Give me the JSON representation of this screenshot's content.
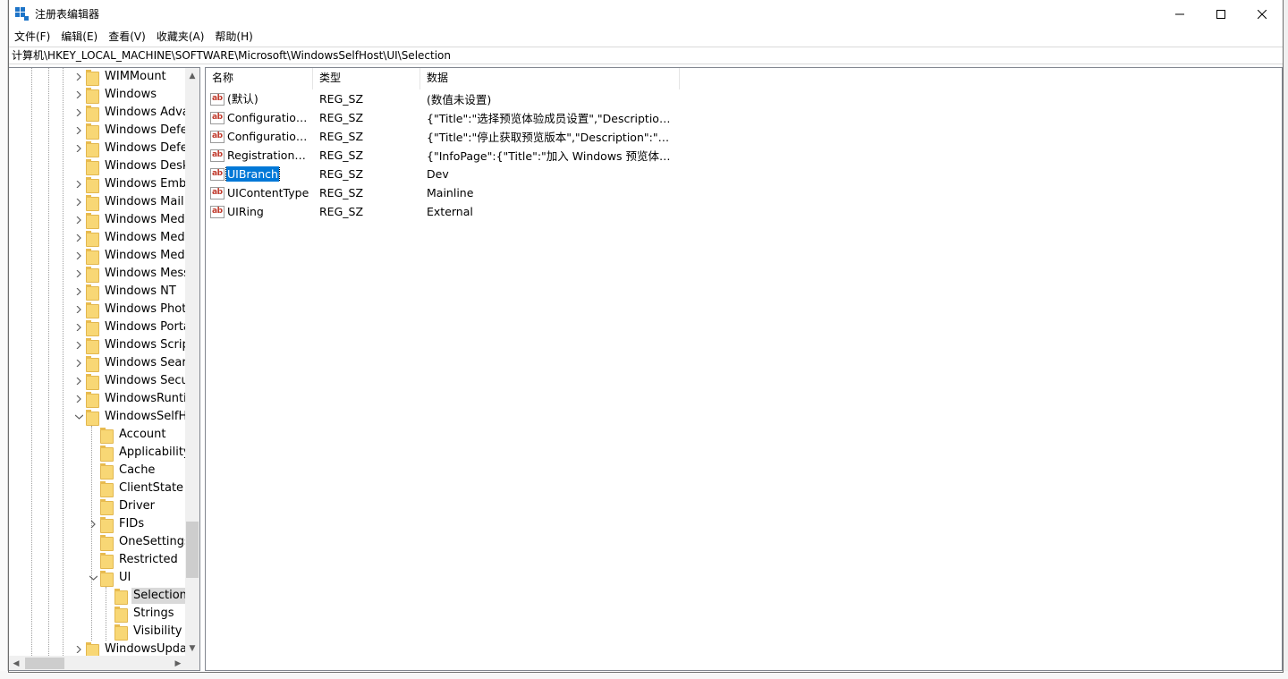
{
  "window": {
    "title": "注册表编辑器"
  },
  "menu": [
    "文件(F)",
    "编辑(E)",
    "查看(V)",
    "收藏夹(A)",
    "帮助(H)"
  ],
  "address": "计算机\\HKEY_LOCAL_MACHINE\\SOFTWARE\\Microsoft\\WindowsSelfHost\\UI\\Selection",
  "tree": [
    {
      "label": "WIMMount",
      "level": 0,
      "expander": "collapsed"
    },
    {
      "label": "Windows",
      "level": 0,
      "expander": "collapsed"
    },
    {
      "label": "Windows Advar",
      "level": 0,
      "expander": "collapsed"
    },
    {
      "label": "Windows Defen",
      "level": 0,
      "expander": "collapsed"
    },
    {
      "label": "Windows Defen",
      "level": 0,
      "expander": "collapsed"
    },
    {
      "label": "Windows Deskt",
      "level": 0,
      "expander": "none"
    },
    {
      "label": "Windows Embe",
      "level": 0,
      "expander": "collapsed"
    },
    {
      "label": "Windows Mail",
      "level": 0,
      "expander": "collapsed"
    },
    {
      "label": "Windows Media",
      "level": 0,
      "expander": "collapsed"
    },
    {
      "label": "Windows Media",
      "level": 0,
      "expander": "collapsed"
    },
    {
      "label": "Windows Media",
      "level": 0,
      "expander": "collapsed"
    },
    {
      "label": "Windows Messa",
      "level": 0,
      "expander": "collapsed"
    },
    {
      "label": "Windows NT",
      "level": 0,
      "expander": "collapsed"
    },
    {
      "label": "Windows Photo",
      "level": 0,
      "expander": "collapsed"
    },
    {
      "label": "Windows Portal",
      "level": 0,
      "expander": "collapsed"
    },
    {
      "label": "Windows Script",
      "level": 0,
      "expander": "collapsed"
    },
    {
      "label": "Windows Searcl",
      "level": 0,
      "expander": "collapsed"
    },
    {
      "label": "Windows Securi",
      "level": 0,
      "expander": "collapsed"
    },
    {
      "label": "WindowsRuntim",
      "level": 0,
      "expander": "collapsed"
    },
    {
      "label": "WindowsSelfHo",
      "level": 0,
      "expander": "expanded"
    },
    {
      "label": "Account",
      "level": 1,
      "expander": "none"
    },
    {
      "label": "Applicability",
      "level": 1,
      "expander": "none"
    },
    {
      "label": "Cache",
      "level": 1,
      "expander": "none"
    },
    {
      "label": "ClientState",
      "level": 1,
      "expander": "none"
    },
    {
      "label": "Driver",
      "level": 1,
      "expander": "none"
    },
    {
      "label": "FIDs",
      "level": 1,
      "expander": "collapsed"
    },
    {
      "label": "OneSettings",
      "level": 1,
      "expander": "none"
    },
    {
      "label": "Restricted",
      "level": 1,
      "expander": "none"
    },
    {
      "label": "UI",
      "level": 1,
      "expander": "expanded"
    },
    {
      "label": "Selection",
      "level": 2,
      "expander": "none",
      "selected": true
    },
    {
      "label": "Strings",
      "level": 2,
      "expander": "none"
    },
    {
      "label": "Visibility",
      "level": 2,
      "expander": "none"
    },
    {
      "label": "WindowsUpdate",
      "level": 0,
      "expander": "collapsed"
    }
  ],
  "columns": {
    "name": "名称",
    "type": "类型",
    "data": "数据"
  },
  "values": [
    {
      "name": "(默认)",
      "type": "REG_SZ",
      "data": "(数值未设置)"
    },
    {
      "name": "ConfigurationB...",
      "type": "REG_SZ",
      "data": "{\"Title\":\"选择预览体验成员设置\",\"Description\":\"..."
    },
    {
      "name": "Configuration...",
      "type": "REG_SZ",
      "data": "{\"Title\":\"停止获取预览版本\",\"Description\":\"\",\"To..."
    },
    {
      "name": "RegistrationFlow",
      "type": "REG_SZ",
      "data": "{\"InfoPage\":{\"Title\":\"加入 Windows 预览体验计..."
    },
    {
      "name": "UIBranch",
      "type": "REG_SZ",
      "data": "Dev",
      "selected": true
    },
    {
      "name": "UIContentType",
      "type": "REG_SZ",
      "data": "Mainline"
    },
    {
      "name": "UIRing",
      "type": "REG_SZ",
      "data": "External"
    }
  ],
  "icons": {
    "value_icon": "string-value-icon",
    "folder": "folder-icon"
  }
}
